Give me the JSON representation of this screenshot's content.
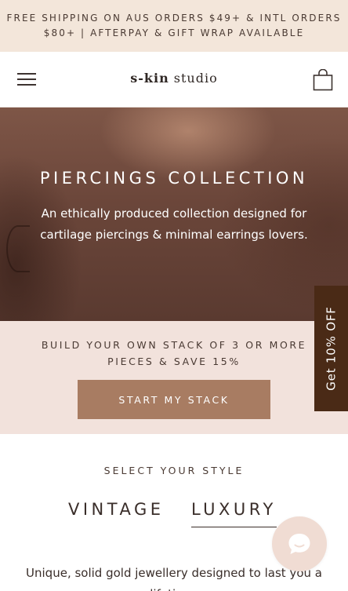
{
  "announcement": {
    "line1": "FREE SHIPPING ON AUS ORDERS $49+ & INTL ORDERS",
    "line2": "$80+ | AFTERPAY & GIFT WRAP AVAILABLE"
  },
  "header": {
    "logo_bold": "s-kin",
    "logo_rest": " studio",
    "menu_icon": "hamburger-menu-icon",
    "cart_icon": "shopping-bag-icon"
  },
  "hero": {
    "title": "PIERCINGS COLLECTION",
    "subtitle": "An ethically produced collection designed for cartilage piercings & minimal earrings lovers."
  },
  "stack_promo": {
    "text": "BUILD YOUR OWN STACK OF 3 OR MORE PIECES & SAVE 15%",
    "button_label": "START MY STACK"
  },
  "side_tab": {
    "label": "Get 10% OFF"
  },
  "style_selector": {
    "heading": "SELECT YOUR STYLE",
    "tabs": [
      "VINTAGE",
      "LUXURY"
    ],
    "active_tab": "LUXURY",
    "description": "Unique, solid gold jewellery designed to last you a lifetime."
  },
  "chat": {
    "icon": "chat-bubble-icon"
  },
  "colors": {
    "announcement_bg": "#f3e6da",
    "stack_bg": "#f2e2dc",
    "button_bg": "#a87c62",
    "side_tab_bg": "#4a2a16",
    "chat_bg": "#f0dcd3"
  }
}
